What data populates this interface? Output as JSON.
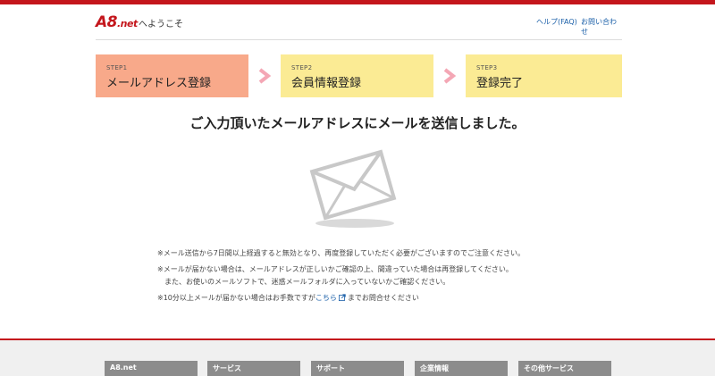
{
  "header": {
    "logo": "A8",
    "logo_suffix": ".net",
    "welcome": "へようこそ",
    "help_link": "ヘルプ(FAQ)",
    "contact_link": "お問い合わせ"
  },
  "steps": [
    {
      "num": "STEP1",
      "title": "メールアドレス登録",
      "state": "current"
    },
    {
      "num": "STEP2",
      "title": "会員情報登録",
      "state": "upcoming"
    },
    {
      "num": "STEP3",
      "title": "登録完了",
      "state": "upcoming"
    }
  ],
  "main": {
    "heading": "ご入力頂いたメールアドレスにメールを送信しました。",
    "icon": "envelope-icon"
  },
  "notes": {
    "note1": "※メール送信から7日間以上経過すると無効となり、再度登録していただく必要がございますのでご注意ください。",
    "note2_line1": "※メールが届かない場合は、メールアドレスが正しいかご確認の上、間違っていた場合は再登録してください。",
    "note2_line2": "また、お使いのメールソフトで、迷惑メールフォルダに入っていないかご確認ください。",
    "note3_before": "※10分以上メールが届かない場合はお手数ですが",
    "note3_link": "こちら",
    "note3_after": "までお問合せください"
  },
  "footer": {
    "items": [
      "A8.net",
      "サービス",
      "サポート",
      "企業情報",
      "その他サービス"
    ]
  },
  "colors": {
    "brand_red": "#c4161c",
    "step_current": "#f8a98a",
    "step_upcoming": "#fbeb94",
    "arrow": "#f4a7b5",
    "link": "#1a5fa8"
  }
}
